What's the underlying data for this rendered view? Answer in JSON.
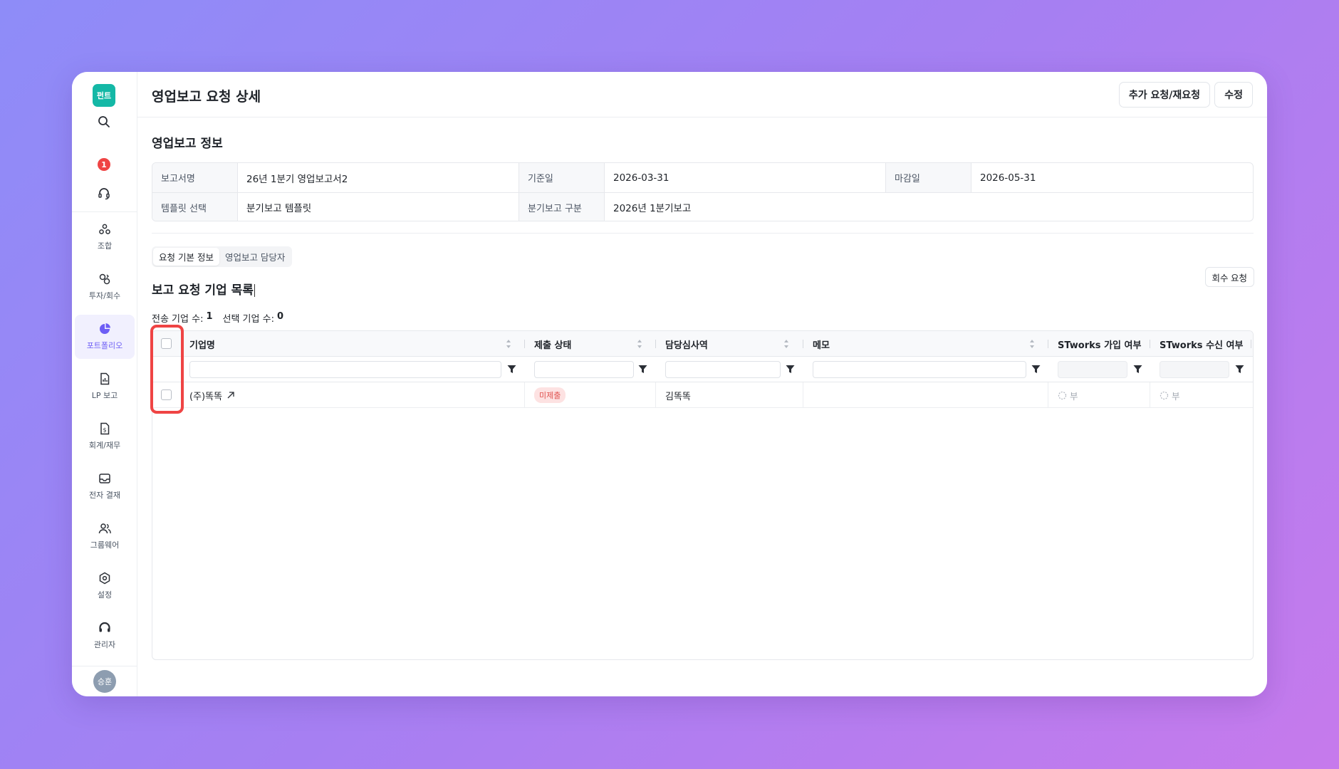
{
  "sidebar": {
    "logo": "펀트",
    "notification_count": "1",
    "items": [
      {
        "label": "조합",
        "icon": "fund-icon"
      },
      {
        "label": "투자/회수",
        "icon": "investment-icon"
      },
      {
        "label": "포트폴리오",
        "icon": "portfolio-icon",
        "active": true
      },
      {
        "label": "LP 보고",
        "icon": "report-icon"
      },
      {
        "label": "회계/재무",
        "icon": "accounting-icon"
      },
      {
        "label": "전자 결재",
        "icon": "approval-icon"
      },
      {
        "label": "그룹웨어",
        "icon": "groupware-icon"
      },
      {
        "label": "설정",
        "icon": "settings-icon"
      },
      {
        "label": "관리자",
        "icon": "admin-icon"
      }
    ],
    "avatar": "승훈"
  },
  "header": {
    "title": "영업보고 요청 상세",
    "additional_request_button": "추가 요청/재요청",
    "edit_button": "수정"
  },
  "info": {
    "section_title": "영업보고 정보",
    "report_name_label": "보고서명",
    "report_name_value": "26년 1분기 영업보고서2",
    "base_date_label": "기준일",
    "base_date_value": "2026-03-31",
    "deadline_label": "마감일",
    "deadline_value": "2026-05-31",
    "template_label": "템플릿 선택",
    "template_value": "분기보고 템플릿",
    "quarter_label": "분기보고 구분",
    "quarter_value": "2026년 1분기보고"
  },
  "tabs": [
    {
      "label": "요청 기본 정보",
      "active": true
    },
    {
      "label": "영업보고 담당자",
      "active": false
    }
  ],
  "list": {
    "title": "보고 요청 기업 목록",
    "collect_button": "회수 요청",
    "sent_label": "전송 기업 수:",
    "sent_count": "1",
    "selected_label": "선택 기업 수:",
    "selected_count": "0",
    "columns": [
      "기업명",
      "제출 상태",
      "담당심사역",
      "메모",
      "STworks 가입 여부",
      "STworks 수신 여부"
    ],
    "rows": [
      {
        "company": "(주)똑똑",
        "status": "미제출",
        "reviewer": "김똑똑",
        "memo": "",
        "stworks_joined": "부",
        "stworks_received": "부"
      }
    ]
  },
  "colors": {
    "accent": "#6d5ef5",
    "logo": "#14b8a6",
    "highlight": "#ef4444",
    "status_badge_bg": "#fde2e2",
    "status_badge_text": "#e0524f"
  }
}
